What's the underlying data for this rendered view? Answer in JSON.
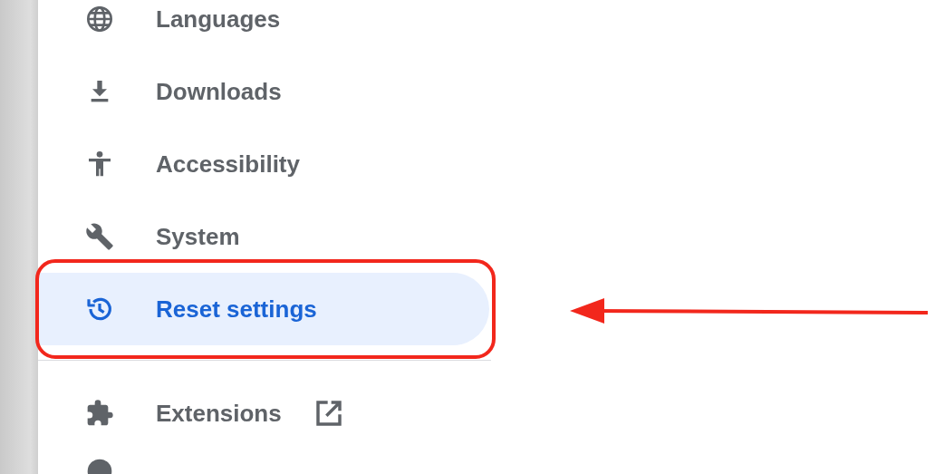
{
  "sidebar": {
    "items": [
      {
        "label": "Languages",
        "selected": false
      },
      {
        "label": "Downloads",
        "selected": false
      },
      {
        "label": "Accessibility",
        "selected": false
      },
      {
        "label": "System",
        "selected": false
      },
      {
        "label": "Reset settings",
        "selected": true
      }
    ],
    "extra_items": [
      {
        "label": "Extensions",
        "external": true
      }
    ]
  }
}
